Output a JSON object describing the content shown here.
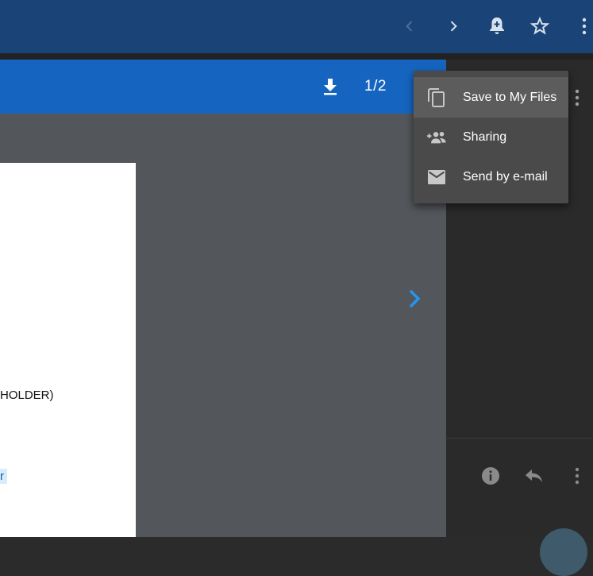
{
  "viewer": {
    "page_counter": "1/2",
    "document_text": {
      "line_1": "HOLDER)",
      "highlight": "r"
    }
  },
  "menu": {
    "items": [
      {
        "label": "Save to My Files",
        "icon": "copy-icon"
      },
      {
        "label": "Sharing",
        "icon": "add-people-icon"
      },
      {
        "label": "Send by e-mail",
        "icon": "mail-icon"
      }
    ]
  },
  "colors": {
    "topbar": "#1a4478",
    "viewer_toolbar": "#1565c0",
    "viewer_bg": "#53565a",
    "menu_bg": "#4a4a4a",
    "accent_arrow": "#2196f3"
  }
}
